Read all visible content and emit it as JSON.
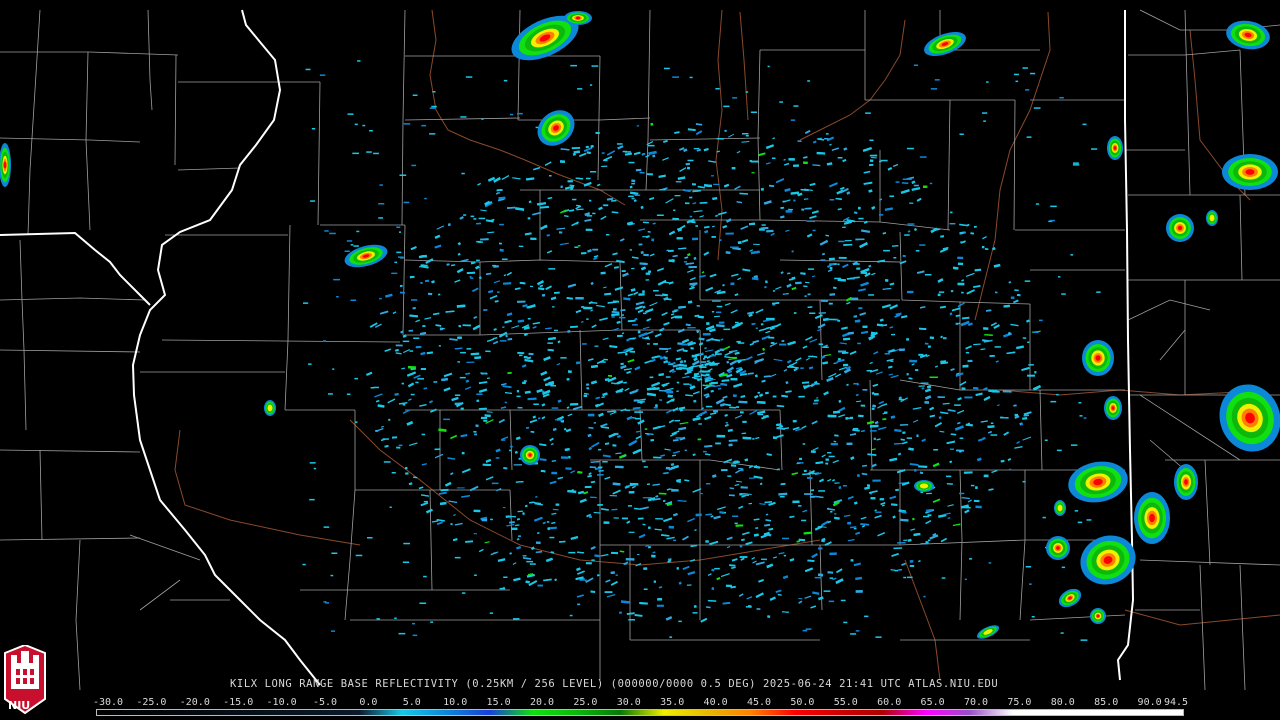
{
  "title": "KILX LONG RANGE BASE REFLECTIVITY (0.25KM / 256 LEVEL) (000000/0000 0.5 DEG) 2025-06-24 21:41 UTC  ATLAS.NIU.EDU",
  "logo": {
    "text": "NIU"
  },
  "legend": {
    "labels": [
      "-30.0",
      "-25.0",
      "-20.0",
      "-15.0",
      "-10.0",
      "-5.0",
      "0.0",
      "5.0",
      "10.0",
      "15.0",
      "20.0",
      "25.0",
      "30.0",
      "35.0",
      "40.0",
      "45.0",
      "50.0",
      "55.0",
      "60.0",
      "65.0",
      "70.0",
      "75.0",
      "80.0",
      "85.0",
      "90.0",
      "94.5"
    ],
    "stops": [
      {
        "v": -30,
        "c": "#000000"
      },
      {
        "v": 0,
        "c": "#0a1a2a"
      },
      {
        "v": 5,
        "c": "#18c8e8"
      },
      {
        "v": 10,
        "c": "#0c88d8"
      },
      {
        "v": 15,
        "c": "#1840d8"
      },
      {
        "v": 20,
        "c": "#10e010"
      },
      {
        "v": 25,
        "c": "#0cb80c"
      },
      {
        "v": 30,
        "c": "#087808"
      },
      {
        "v": 35,
        "c": "#f0f000"
      },
      {
        "v": 40,
        "c": "#e8b800"
      },
      {
        "v": 45,
        "c": "#ff8000"
      },
      {
        "v": 50,
        "c": "#ff0000"
      },
      {
        "v": 55,
        "c": "#d00000"
      },
      {
        "v": 60,
        "c": "#b00000"
      },
      {
        "v": 65,
        "c": "#ff00ff"
      },
      {
        "v": 70,
        "c": "#9850c8"
      },
      {
        "v": 75,
        "c": "#ffffff"
      },
      {
        "v": 94.5,
        "c": "#ffffff"
      }
    ]
  },
  "colors": {
    "state_border": "#ffffff",
    "county_border": "#a0a0a0",
    "river": "#8b4a2a",
    "echo_light": "#18c8e8",
    "echo_blue": "#0c88d8"
  }
}
